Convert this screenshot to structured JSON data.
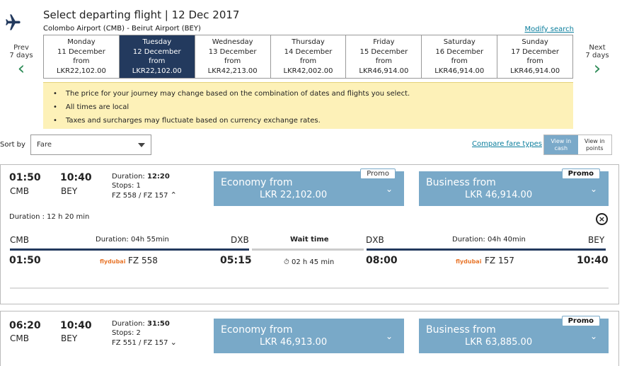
{
  "header": {
    "title": "Select departing flight | 12 Dec 2017",
    "route": "Colombo Airport (CMB) - Beirut Airport (BEY)",
    "modify_search": "Modify search"
  },
  "nav": {
    "prev_label": "Prev",
    "prev_days": "7 days",
    "next_label": "Next",
    "next_days": "7 days"
  },
  "dates": [
    {
      "weekday": "Monday",
      "date": "11 December",
      "from": "from",
      "price": "LKR22,102.00",
      "selected": false
    },
    {
      "weekday": "Tuesday",
      "date": "12 December",
      "from": "from",
      "price": "LKR22,102.00",
      "selected": true
    },
    {
      "weekday": "Wednesday",
      "date": "13 December",
      "from": "from",
      "price": "LKR42,213.00",
      "selected": false
    },
    {
      "weekday": "Thursday",
      "date": "14 December",
      "from": "from",
      "price": "LKR42,002.00",
      "selected": false
    },
    {
      "weekday": "Friday",
      "date": "15 December",
      "from": "from",
      "price": "LKR46,914.00",
      "selected": false
    },
    {
      "weekday": "Saturday",
      "date": "16 December",
      "from": "from",
      "price": "LKR46,914.00",
      "selected": false
    },
    {
      "weekday": "Sunday",
      "date": "17 December",
      "from": "from",
      "price": "LKR46,914.00",
      "selected": false
    }
  ],
  "notices": [
    "The price for your journey may change based on the combination of dates and flights you select.",
    "All times are local",
    "Taxes and surcharges may fluctuate based on currency exchange rates."
  ],
  "sort": {
    "label": "Sort by",
    "value": "Fare",
    "compare_link": "Compare fare types",
    "toggle_cash": "View in cash",
    "toggle_points": "View in points"
  },
  "flights": [
    {
      "depart_time": "01:50",
      "depart_code": "CMB",
      "arrive_time": "10:40",
      "arrive_code": "BEY",
      "duration_label": "Duration:",
      "duration": "12:20",
      "stops_text": "Stops: 1",
      "flight_numbers": "FZ 558 / FZ 157",
      "economy_label": "Economy from",
      "economy_price": "LKR 22,102.00",
      "economy_promo": "Promo",
      "business_label": "Business from",
      "business_price": "LKR 46,914.00",
      "business_promo": "Promo",
      "details": {
        "total_duration": "Duration : 12 h 20 min",
        "seg1_from": "CMB",
        "seg1_duration": "Duration: 04h 55min",
        "seg1_to": "DXB",
        "seg1_dep": "01:50",
        "seg1_flight": "FZ 558",
        "seg1_arr": "05:15",
        "wait_label": "Wait time",
        "wait_time": "02 h 45 min",
        "seg2_from": "DXB",
        "seg2_duration": "Duration: 04h 40min",
        "seg2_to": "BEY",
        "seg2_dep": "08:00",
        "seg2_flight": "FZ 157",
        "seg2_arr": "10:40",
        "airline_logo": "flydubai"
      }
    },
    {
      "depart_time": "06:20",
      "depart_code": "CMB",
      "arrive_time": "10:40",
      "arrive_code": "BEY",
      "duration_label": "Duration:",
      "duration": "31:50",
      "stops_text": "Stops: 2",
      "flight_numbers": "FZ 551 / FZ 157",
      "economy_label": "Economy from",
      "economy_price": "LKR 46,913.00",
      "business_label": "Business from",
      "business_price": "LKR 63,885.00",
      "business_promo": "Promo"
    }
  ],
  "icons": {
    "plane": "airplane-icon",
    "chevron_left": "chevron-left-icon",
    "chevron_right": "chevron-right-icon",
    "close": "close-icon",
    "clock": "clock-icon"
  },
  "colors": {
    "selected_date_bg": "#233a5e",
    "fare_box_bg": "#79a9c8",
    "notice_bg": "#fdf1b8",
    "link": "#0a7d9c",
    "chevron": "#2e8b57"
  }
}
